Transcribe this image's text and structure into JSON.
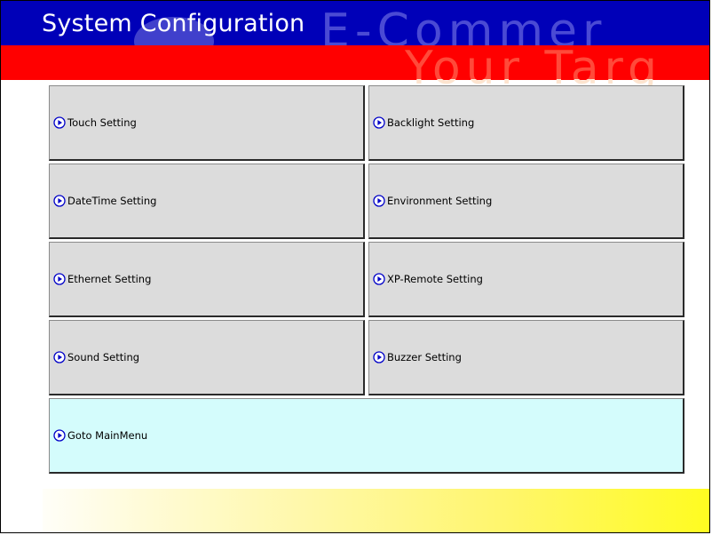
{
  "header": {
    "title": "System Configuration",
    "watermark_line1": "E-Commer",
    "watermark_line2": "Your Targ"
  },
  "buttons": [
    {
      "label": "Touch Setting"
    },
    {
      "label": "Backlight Setting"
    },
    {
      "label": "DateTime Setting"
    },
    {
      "label": "Environment Setting"
    },
    {
      "label": "Ethernet Setting"
    },
    {
      "label": "XP-Remote Setting"
    },
    {
      "label": "Sound Setting"
    },
    {
      "label": "Buzzer Setting"
    }
  ],
  "goto_main": {
    "label": "Goto MainMenu"
  },
  "icons": {
    "button_icon": "play-circle-icon"
  },
  "colors": {
    "title_bar": "#0000b8",
    "red_band": "#ff0000",
    "button_bg": "#dcdcdc",
    "main_menu_bg": "#d4fcfc",
    "icon_blue": "#0000c8",
    "gradient_end": "#fffc20"
  }
}
